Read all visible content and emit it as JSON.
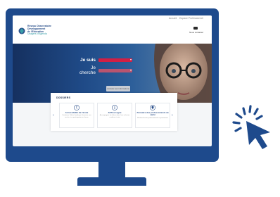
{
  "topbar": {
    "links": [
      "Accueil",
      "Espace Professionnel"
    ],
    "logo_lines": [
      "Réseau Observatoire",
      "Développement",
      "de l'Education"
    ],
    "logo_sub": "Usagers d'Agenda",
    "contact_label": "Nous contacter"
  },
  "hero": {
    "i_am_label": "Je suis",
    "looking_label": "Je cherche",
    "go_button": "Accéder aux informations"
  },
  "dossiers": {
    "title": "DOSSIERS",
    "cards": [
      {
        "title": "Accessibilité de l'école",
        "desc": "Scolariser l'élève handicapé, favoriser son accès et sa participation en classe",
        "icon": "wheelchair-icon"
      },
      {
        "title": "Jeffrou Ligue",
        "desc": "Accompagner les élèves dans leur inclusion scolaire et suivi",
        "icon": "info-icon"
      },
      {
        "title": "Annuaire des professionnels de santé",
        "desc": "Recherchez les professionnels et partenaires",
        "icon": "pin-icon"
      }
    ]
  },
  "colors": {
    "monitor": "#1e4a8c",
    "accent_red": "#d21f44",
    "cursor": "#1e4a8c"
  }
}
